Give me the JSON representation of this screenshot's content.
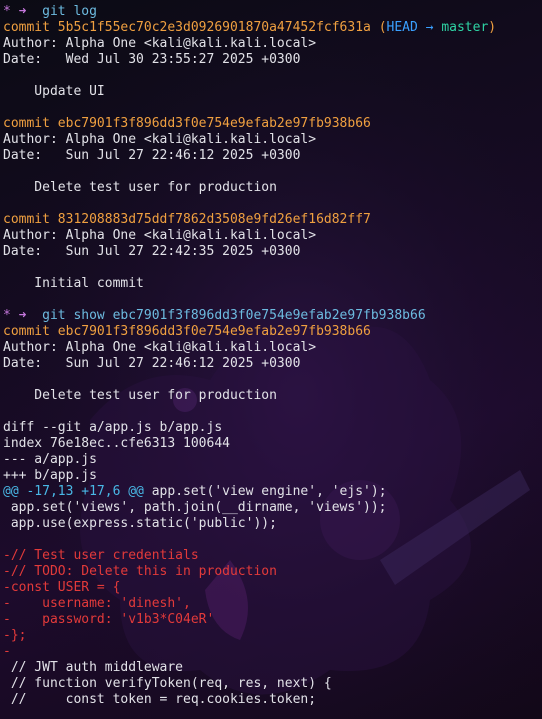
{
  "theme": {
    "background": "#140b20",
    "prompt_color": "#c678dd",
    "command_color": "#6dbbe0",
    "commit_color": "#f0a040",
    "head_color": "#3aa0ff",
    "branch_color": "#2ed3a4",
    "removed_color": "#e33a3a",
    "hunk_color": "#49b8e6"
  },
  "prompt": {
    "symbol": "*",
    "arrow": "➜"
  },
  "log_cmd": "git log",
  "log": [
    {
      "commit_label": "commit 5b5c1f55ec70c2e3d0926901870a47452fcf631a",
      "head": "HEAD",
      "head_arrow": "→",
      "branch": "master",
      "author": "Author: Alpha One <kali@kali.kali.local>",
      "date": "Date:   Wed Jul 30 23:55:27 2025 +0300",
      "message": "    Update UI"
    },
    {
      "commit_label": "commit ebc7901f3f896dd3f0e754e9efab2e97fb938b66",
      "author": "Author: Alpha One <kali@kali.kali.local>",
      "date": "Date:   Sun Jul 27 22:46:12 2025 +0300",
      "message": "    Delete test user for production"
    },
    {
      "commit_label": "commit 831208883d75ddf7862d3508e9fd26ef16d82ff7",
      "author": "Author: Alpha One <kali@kali.kali.local>",
      "date": "Date:   Sun Jul 27 22:42:35 2025 +0300",
      "message": "    Initial commit"
    }
  ],
  "show_cmd": "git show ebc7901f3f896dd3f0e754e9efab2e97fb938b66",
  "show": {
    "commit_label": "commit ebc7901f3f896dd3f0e754e9efab2e97fb938b66",
    "author": "Author: Alpha One <kali@kali.kali.local>",
    "date": "Date:   Sun Jul 27 22:46:12 2025 +0300",
    "message": "    Delete test user for production"
  },
  "diff": {
    "header": "diff --git a/app.js b/app.js",
    "index": "index 76e18ec..cfe6313 100644",
    "old_file": "--- a/app.js",
    "new_file": "+++ b/app.js",
    "hunk_range": "@@ -17,13 +17,6 @@",
    "hunk_context": " app.set('view engine', 'ejs');",
    "context_before": [
      " app.set('views', path.join(__dirname, 'views'));",
      " app.use(express.static('public'));",
      " "
    ],
    "removed": [
      "-// Test user credentials",
      "-// TODO: Delete this in production",
      "-const USER = {",
      "-    username: 'dinesh',",
      "-    password: 'v1b3*C04eR'",
      "-};",
      "-"
    ],
    "context_after": [
      " // JWT auth middleware",
      " // function verifyToken(req, res, next) {",
      " //     const token = req.cookies.token;"
    ]
  }
}
